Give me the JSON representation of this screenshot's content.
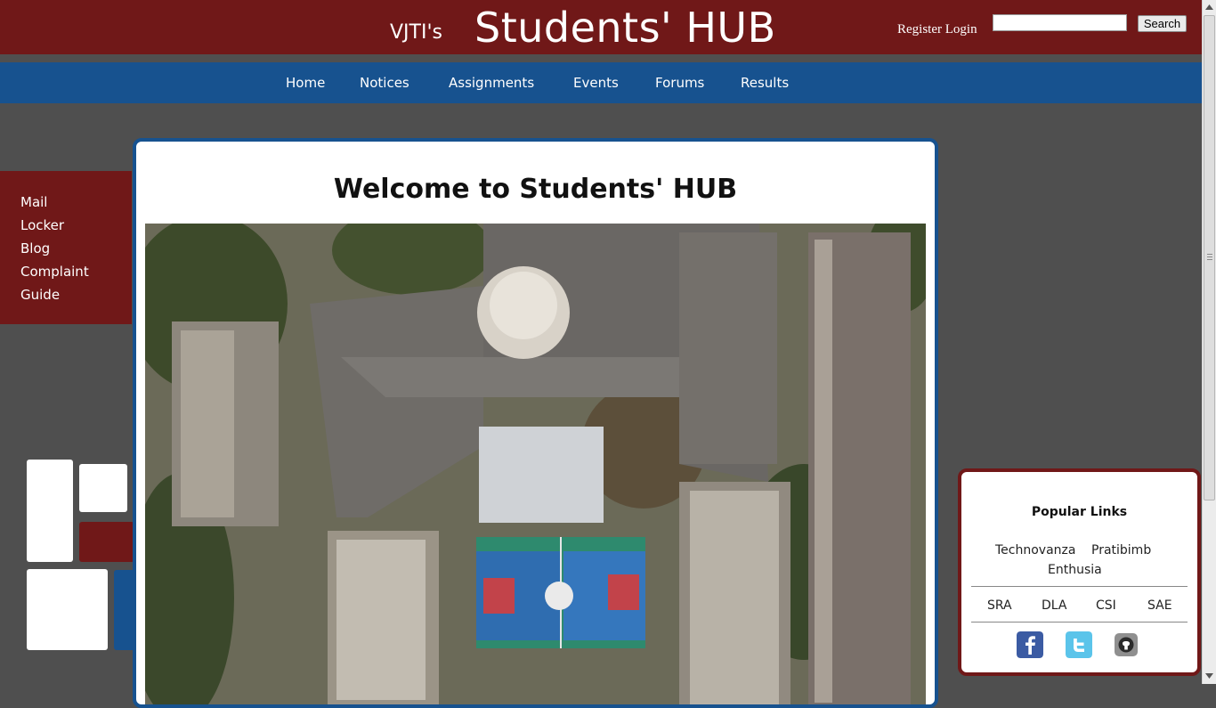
{
  "header": {
    "brand_small": "VJTI's",
    "brand_big": "Students' HUB",
    "register_label": "Register",
    "login_label": "Login",
    "search_value": "",
    "search_button": "Search"
  },
  "nav": {
    "items": [
      {
        "label": "Home"
      },
      {
        "label": "Notices"
      },
      {
        "label": "Assignments"
      },
      {
        "label": "Events"
      },
      {
        "label": "Forums"
      },
      {
        "label": "Results"
      }
    ]
  },
  "sidebar": {
    "links": [
      {
        "label": "Mail"
      },
      {
        "label": "Locker"
      },
      {
        "label": "Blog"
      },
      {
        "label": "Complaint"
      },
      {
        "label": "Guide"
      }
    ]
  },
  "main": {
    "heading": "Welcome to Students' HUB"
  },
  "popular": {
    "title": "Popular Links",
    "festivals": [
      "Technovanza",
      "Pratibimb",
      "Enthusia"
    ],
    "clubs": [
      "SRA",
      "DLA",
      "CSI",
      "SAE"
    ],
    "social_icons": [
      "facebook-icon",
      "twitter-icon",
      "github-icon"
    ]
  },
  "colors": {
    "header_bg": "#701818",
    "nav_bg": "#17528f",
    "page_bg": "#4f4f4f"
  }
}
